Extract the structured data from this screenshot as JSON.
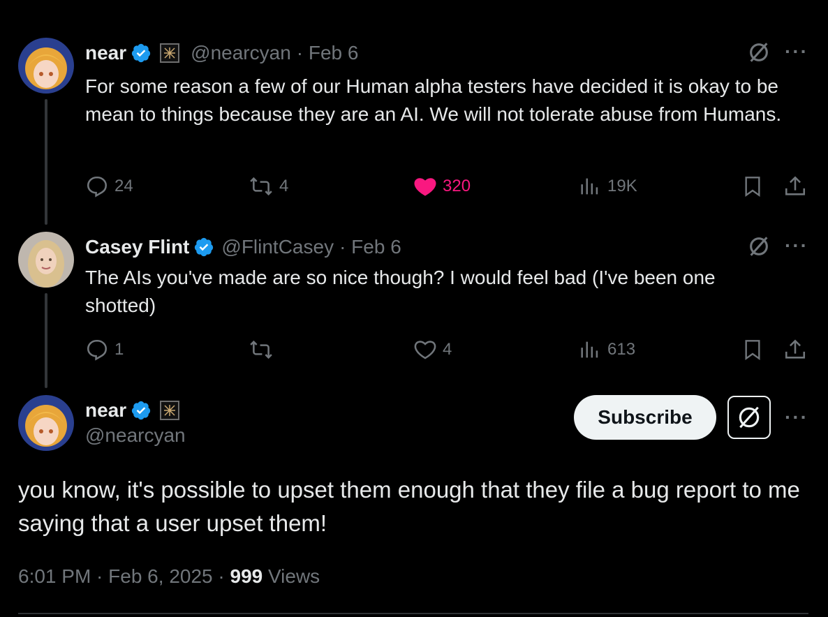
{
  "tweets": [
    {
      "name": "near",
      "handle": "@nearcyan",
      "date": "· Feb 6",
      "text": "For some reason a few of our Human alpha testers have decided it is okay to be mean to things because they are an AI. We will not tolerate abuse from Humans.",
      "replies": "24",
      "retweets": "4",
      "likes": "320",
      "views": "19K",
      "liked": true
    },
    {
      "name": "Casey Flint",
      "handle": "@FlintCasey",
      "date": "· Feb 6",
      "text": "The AIs you've made are so nice though? I would feel bad (I've been one shotted)",
      "replies": "1",
      "retweets": "",
      "likes": "4",
      "views": "613",
      "liked": false
    }
  ],
  "main_tweet": {
    "name": "near",
    "handle": "@nearcyan",
    "subscribe_label": "Subscribe",
    "text": "you know, it's possible to upset them enough that they file a bug report to me saying that a user upset them!",
    "time": "6:01 PM · Feb 6, 2025 · ",
    "views_count": "999",
    "views_label": " Views"
  },
  "more_label": "···",
  "colors": {
    "background": "#000000",
    "text": "#e7e9ea",
    "muted": "#71767b",
    "like": "#f91880",
    "verified": "#1d9bf0"
  },
  "icons": {
    "reply": "reply-icon",
    "retweet": "retweet-icon",
    "like": "heart-icon",
    "views": "views-icon",
    "bookmark": "bookmark-icon",
    "share": "share-icon",
    "grok": "grok-icon",
    "verified": "verified-badge-icon"
  }
}
